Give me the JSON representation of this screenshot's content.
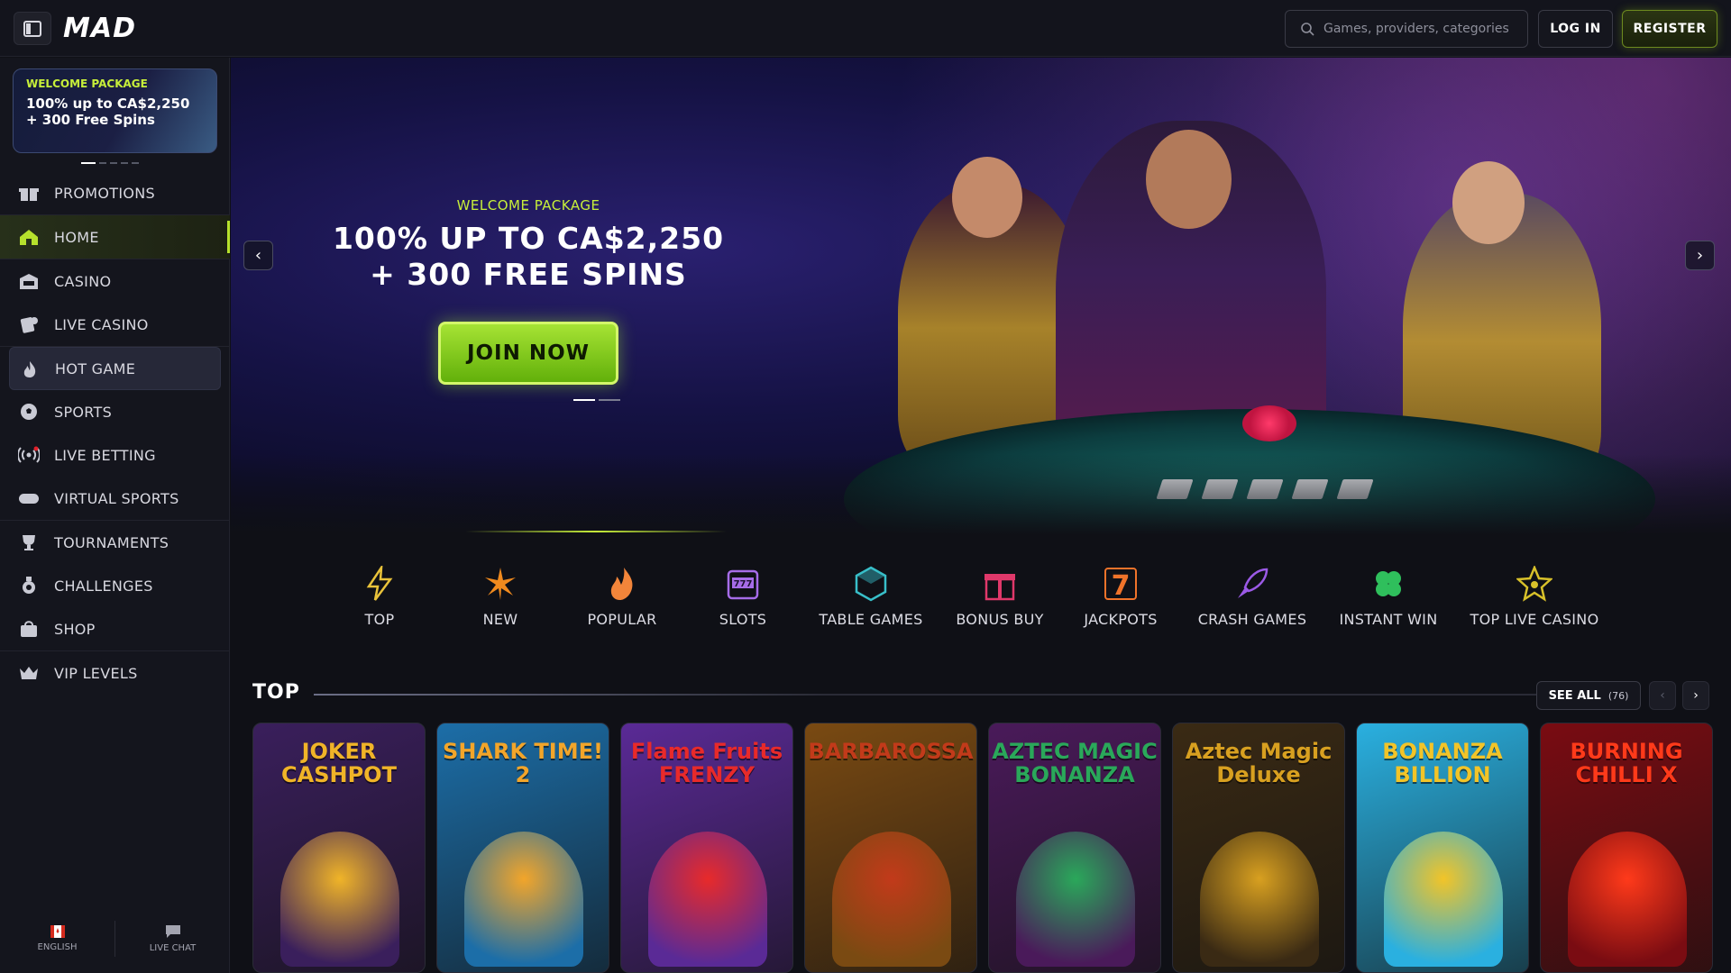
{
  "header": {
    "logo": "MAD",
    "search_placeholder": "Games, providers, categories",
    "login_label": "LOG IN",
    "register_label": "REGISTER"
  },
  "sidebar": {
    "promo": {
      "tag": "WELCOME PACKAGE",
      "text": "100% up to CA$2,250 + 300 Free Spins"
    },
    "items": [
      {
        "label": "PROMOTIONS",
        "icon": "gift-icon"
      },
      {
        "label": "HOME",
        "icon": "home-icon"
      },
      {
        "label": "CASINO",
        "icon": "casino-icon"
      },
      {
        "label": "LIVE CASINO",
        "icon": "live-casino-icon"
      },
      {
        "label": "HOT GAME",
        "icon": "fire-icon"
      },
      {
        "label": "SPORTS",
        "icon": "soccer-ball-icon"
      },
      {
        "label": "LIVE BETTING",
        "icon": "broadcast-icon"
      },
      {
        "label": "VIRTUAL SPORTS",
        "icon": "gamepad-icon"
      },
      {
        "label": "TOURNAMENTS",
        "icon": "trophy-icon"
      },
      {
        "label": "CHALLENGES",
        "icon": "medal-icon"
      },
      {
        "label": "SHOP",
        "icon": "shopping-bag-icon"
      },
      {
        "label": "VIP LEVELS",
        "icon": "crown-icon"
      }
    ],
    "language_label": "ENGLISH",
    "chat_label": "LIVE CHAT"
  },
  "hero": {
    "tag": "WELCOME PACKAGE",
    "title_line1": "100% UP TO CA$2,250",
    "title_line2": "+ 300 FREE SPINS",
    "cta": "JOIN NOW"
  },
  "categories": [
    {
      "label": "TOP",
      "icon": "lightning-icon",
      "color": "#e8c23a"
    },
    {
      "label": "NEW",
      "icon": "star-burst-icon",
      "color": "#f08a1e"
    },
    {
      "label": "POPULAR",
      "icon": "flame-icon",
      "color": "#f2853a"
    },
    {
      "label": "SLOTS",
      "icon": "slot-machine-icon",
      "color": "#a66ce8"
    },
    {
      "label": "TABLE GAMES",
      "icon": "dice-icon",
      "color": "#38bfc9"
    },
    {
      "label": "BONUS BUY",
      "icon": "gift-box-icon",
      "color": "#e0386a"
    },
    {
      "label": "JACKPOTS",
      "icon": "seven-icon",
      "color": "#f0732a"
    },
    {
      "label": "CRASH GAMES",
      "icon": "rocket-icon",
      "color": "#9b5ae6"
    },
    {
      "label": "INSTANT WIN",
      "icon": "clover-icon",
      "color": "#2fbf5c"
    },
    {
      "label": "TOP LIVE CASINO",
      "icon": "star-badge-icon",
      "color": "#d8c12a"
    }
  ],
  "top_section": {
    "title": "TOP",
    "see_all": "SEE ALL",
    "count": "(76)",
    "games": [
      {
        "title": "JOKER CASHPOT",
        "bg": "#3a1f5c",
        "accent": "#f0b428"
      },
      {
        "title": "SHARK TIME! 2",
        "bg": "#1c6ea8",
        "accent": "#f2a52a"
      },
      {
        "title": "Flame Fruits FRENZY",
        "bg": "#5a2a96",
        "accent": "#e82a2a"
      },
      {
        "title": "BARBAROSSA",
        "bg": "#7a4a12",
        "accent": "#c23a1a"
      },
      {
        "title": "AZTEC MAGIC BONANZA",
        "bg": "#4a1a5a",
        "accent": "#2aa85a"
      },
      {
        "title": "Aztec Magic Deluxe",
        "bg": "#3a2a14",
        "accent": "#d8a020"
      },
      {
        "title": "BONANZA BILLION",
        "bg": "#2ab0e0",
        "accent": "#f2c428"
      },
      {
        "title": "BURNING CHILLI X",
        "bg": "#7a0c12",
        "accent": "#ff3a1a"
      }
    ]
  }
}
